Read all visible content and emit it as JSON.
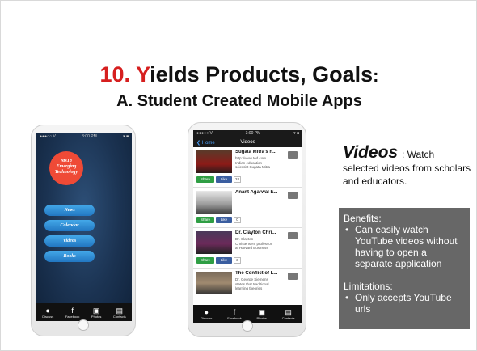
{
  "title": {
    "number": "10.",
    "first_letter": "Y",
    "rest": "ields Products, Goals",
    "colon": ":",
    "subtitle": "A. Student Created Mobile Apps"
  },
  "phone1": {
    "status_left": "●●●○○ V",
    "status_time": "3:00 PM",
    "status_right": "▾ ■",
    "logo_line1": "Ms18",
    "logo_line2": "Emerging",
    "logo_line3": "Technology",
    "menu": [
      "News",
      "Calendar",
      "Videos",
      "Books"
    ],
    "tabs": [
      "Discuss",
      "Facebook",
      "Photos",
      "Contacts"
    ]
  },
  "phone2": {
    "status_left": "●●●○○ V",
    "status_time": "3:00 PM",
    "status_right": "▾ ■",
    "back_label": "Home",
    "nav_title": "Videos",
    "share_label": "Share",
    "like_label": "Like",
    "videos": [
      {
        "title": "Sugata Mitra's n...",
        "desc": [
          "http://www.ted.com",
          "Indian education",
          "scientist Sugata Mitra"
        ],
        "count": "24"
      },
      {
        "title": "Anant Agarwal E...",
        "desc": [],
        "count": "0"
      },
      {
        "title": "Dr. Clayton Chri...",
        "desc": [
          "Dr. Clayton",
          "Christensen, professor",
          "at Harvard Business"
        ],
        "count": "3"
      },
      {
        "title": "The Conflict of L...",
        "desc": [
          "Dr. George Siemens",
          "states that traditional",
          "learning theories"
        ],
        "count": ""
      }
    ],
    "tabs": [
      "Discuss",
      "Facebook",
      "Photos",
      "Contacts"
    ]
  },
  "videos_section": {
    "heading": "Videos",
    "desc_first": ": Watch",
    "desc_rest": "selected videos from scholars and educators."
  },
  "info_box": {
    "benefits_heading": "Benefits:",
    "benefits": [
      "Can easily watch YouTube videos without having to open a separate application"
    ],
    "limitations_heading": "Limitations:",
    "limitations": [
      "Only accepts YouTube urls"
    ]
  }
}
